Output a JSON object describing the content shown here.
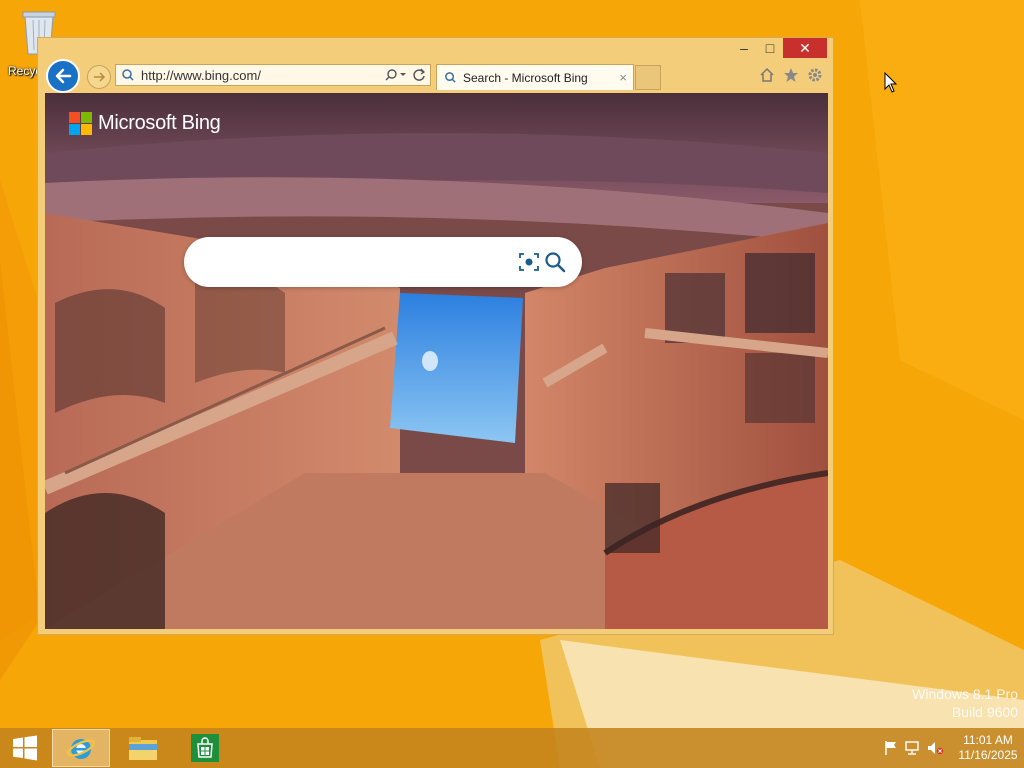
{
  "desktop": {
    "recycle_bin_label": "Recycle Bin",
    "watermark_line1": "Windows 8.1 Pro",
    "watermark_line2": "Build 9600"
  },
  "browser": {
    "address_url": "http://www.bing.com/",
    "tab_title": "Search - Microsoft Bing",
    "tab_close": "×",
    "window_buttons": {
      "minimize": "–",
      "maximize": "□",
      "close": "✕"
    }
  },
  "page": {
    "brand": "Microsoft Bing",
    "search_placeholder": "",
    "logo_colors": [
      "#f25022",
      "#7fba00",
      "#00a4ef",
      "#ffb900"
    ]
  },
  "taskbar": {
    "apps": [
      {
        "name": "Internet Explorer",
        "icon": "ie-icon",
        "active": true
      },
      {
        "name": "File Explorer",
        "icon": "folder-icon",
        "active": false
      },
      {
        "name": "Store",
        "icon": "store-icon",
        "active": false
      }
    ],
    "tray_icons": [
      "flag-icon",
      "network-icon",
      "speaker-muted-icon"
    ],
    "time": "11:01 AM",
    "date": "11/16/2025"
  },
  "colors": {
    "accent_blue": "#1a72c6",
    "taskbar": "#c4841e",
    "close_red": "#c7302c"
  }
}
